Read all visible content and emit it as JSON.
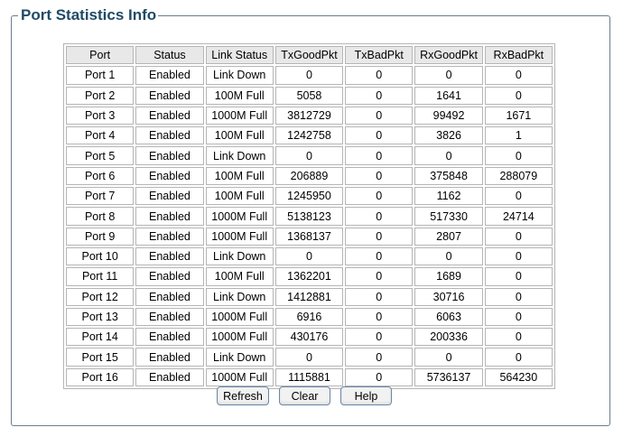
{
  "panel": {
    "title": "Port Statistics Info"
  },
  "table": {
    "headers": [
      "Port",
      "Status",
      "Link Status",
      "TxGoodPkt",
      "TxBadPkt",
      "RxGoodPkt",
      "RxBadPkt"
    ],
    "rows": [
      [
        "Port 1",
        "Enabled",
        "Link Down",
        "0",
        "0",
        "0",
        "0"
      ],
      [
        "Port 2",
        "Enabled",
        "100M Full",
        "5058",
        "0",
        "1641",
        "0"
      ],
      [
        "Port 3",
        "Enabled",
        "1000M Full",
        "3812729",
        "0",
        "99492",
        "1671"
      ],
      [
        "Port 4",
        "Enabled",
        "100M Full",
        "1242758",
        "0",
        "3826",
        "1"
      ],
      [
        "Port 5",
        "Enabled",
        "Link Down",
        "0",
        "0",
        "0",
        "0"
      ],
      [
        "Port 6",
        "Enabled",
        "100M Full",
        "206889",
        "0",
        "375848",
        "288079"
      ],
      [
        "Port 7",
        "Enabled",
        "100M Full",
        "1245950",
        "0",
        "1162",
        "0"
      ],
      [
        "Port 8",
        "Enabled",
        "1000M Full",
        "5138123",
        "0",
        "517330",
        "24714"
      ],
      [
        "Port 9",
        "Enabled",
        "1000M Full",
        "1368137",
        "0",
        "2807",
        "0"
      ],
      [
        "Port 10",
        "Enabled",
        "Link Down",
        "0",
        "0",
        "0",
        "0"
      ],
      [
        "Port 11",
        "Enabled",
        "100M Full",
        "1362201",
        "0",
        "1689",
        "0"
      ],
      [
        "Port 12",
        "Enabled",
        "Link Down",
        "1412881",
        "0",
        "30716",
        "0"
      ],
      [
        "Port 13",
        "Enabled",
        "1000M Full",
        "6916",
        "0",
        "6063",
        "0"
      ],
      [
        "Port 14",
        "Enabled",
        "1000M Full",
        "430176",
        "0",
        "200336",
        "0"
      ],
      [
        "Port 15",
        "Enabled",
        "Link Down",
        "0",
        "0",
        "0",
        "0"
      ],
      [
        "Port 16",
        "Enabled",
        "1000M Full",
        "1115881",
        "0",
        "5736137",
        "564230"
      ]
    ]
  },
  "buttons": {
    "refresh": "Refresh",
    "clear": "Clear",
    "help": "Help"
  },
  "colors": {
    "title": "#1f4a66",
    "panel_border": "#6b7c8c",
    "header_bg": "#e8e8e8",
    "cell_border": "#b5b5b5",
    "button_border": "#6a87a8"
  }
}
